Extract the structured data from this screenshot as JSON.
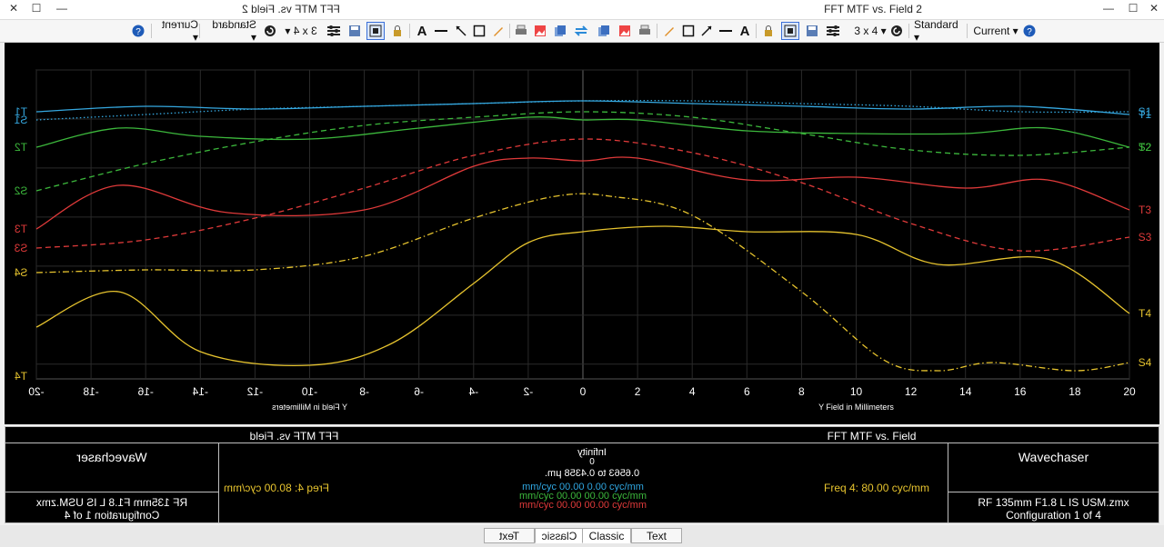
{
  "window": {
    "title": "FFT MTF vs. Field 2",
    "title_mirrored": "FFT MTF vs. Field 2",
    "controls": {
      "minimize": "—",
      "maximize": "☐",
      "close": "✕"
    }
  },
  "toolbar_left": {
    "buttons": [
      "Current ▾",
      "Standard ▾",
      "3 x 4 ▾"
    ]
  },
  "toolbar_right": {
    "layout": "3 x 4 ▾",
    "standard": "Standard ▾",
    "current": "Current ▾"
  },
  "plot": {
    "left_x_label": "Y Field in Millimeters",
    "right_x_label": "Y Field in Millimeters",
    "x_ticks_left": [
      "-20",
      "-18",
      "-16",
      "-14",
      "-12",
      "-10",
      "-8",
      "-6",
      "-4",
      "-2",
      "0"
    ],
    "x_ticks_right": [
      "2",
      "4",
      "6",
      "8",
      "10",
      "12",
      "14",
      "16",
      "18",
      "20"
    ]
  },
  "chart_data": {
    "type": "line",
    "title": "FFT MTF vs. Field",
    "xlabel": "Y Field in Millimeters",
    "ylabel": "",
    "xlim": [
      -20,
      20
    ],
    "ylim": [
      0,
      1
    ],
    "grid": true,
    "series": [
      {
        "name": "T1",
        "color": "#35a8e0",
        "style": "solid",
        "x": [
          -20,
          -16,
          -12,
          -8,
          -4,
          0,
          4,
          8,
          12,
          16,
          20
        ],
        "y": [
          0.94,
          0.96,
          0.95,
          0.96,
          0.97,
          0.98,
          0.97,
          0.96,
          0.95,
          0.96,
          0.93
        ]
      },
      {
        "name": "S1",
        "color": "#35a8e0",
        "style": "dotted",
        "x": [
          -20,
          -16,
          -12,
          -8,
          -4,
          0,
          4,
          8,
          12,
          16,
          20
        ],
        "y": [
          0.91,
          0.93,
          0.95,
          0.96,
          0.97,
          0.98,
          0.98,
          0.97,
          0.96,
          0.94,
          0.94
        ]
      },
      {
        "name": "T2",
        "color": "#3cb83c",
        "style": "solid",
        "x": [
          -20,
          -17,
          -14,
          -10,
          -6,
          -2,
          0,
          2,
          6,
          10,
          14,
          17,
          20
        ],
        "y": [
          0.81,
          0.88,
          0.85,
          0.84,
          0.88,
          0.92,
          0.91,
          0.91,
          0.87,
          0.86,
          0.86,
          0.88,
          0.81
        ]
      },
      {
        "name": "S2",
        "color": "#3cb83c",
        "style": "dashed",
        "x": [
          -20,
          -16,
          -12,
          -8,
          -4,
          0,
          4,
          8,
          12,
          16,
          20
        ],
        "y": [
          0.65,
          0.75,
          0.83,
          0.89,
          0.92,
          0.94,
          0.92,
          0.86,
          0.8,
          0.78,
          0.81
        ]
      },
      {
        "name": "T3",
        "color": "#e03a3a",
        "style": "solid",
        "x": [
          -20,
          -17,
          -13,
          -8,
          -4,
          -2,
          0,
          2,
          6,
          10,
          14,
          17,
          20
        ],
        "y": [
          0.51,
          0.67,
          0.57,
          0.58,
          0.74,
          0.77,
          0.76,
          0.77,
          0.69,
          0.7,
          0.66,
          0.69,
          0.58
        ]
      },
      {
        "name": "S3",
        "color": "#e03a3a",
        "style": "dashed",
        "x": [
          -20,
          -16,
          -12,
          -8,
          -4,
          0,
          4,
          8,
          12,
          16,
          20
        ],
        "y": [
          0.44,
          0.47,
          0.55,
          0.66,
          0.78,
          0.84,
          0.79,
          0.68,
          0.53,
          0.43,
          0.48
        ]
      },
      {
        "name": "T4",
        "color": "#e6c32e",
        "style": "solid",
        "x": [
          -20,
          -17,
          -14,
          -10,
          -7,
          -4,
          -2,
          0,
          3,
          6,
          10,
          13,
          17,
          20
        ],
        "y": [
          0.15,
          0.28,
          0.06,
          0.01,
          0.09,
          0.31,
          0.46,
          0.5,
          0.52,
          0.5,
          0.49,
          0.38,
          0.4,
          0.2
        ]
      },
      {
        "name": "S4",
        "color": "#e6c32e",
        "style": "dashdot",
        "x": [
          -20,
          -16,
          -12,
          -8,
          -4,
          -1,
          1,
          4,
          8,
          11,
          13,
          15,
          18,
          20
        ],
        "y": [
          0.35,
          0.36,
          0.36,
          0.41,
          0.55,
          0.63,
          0.63,
          0.56,
          0.28,
          0.03,
          -0.01,
          0.02,
          -0.01,
          0.02
        ]
      }
    ],
    "left_labels": [
      "T1",
      "S1",
      "T2",
      "S2",
      "T3",
      "S3",
      "S4",
      "T4"
    ],
    "right_labels": [
      "S1",
      "T1",
      "S2",
      "T2",
      "T3",
      "S3",
      "T4",
      "S4"
    ]
  },
  "info": {
    "title_right": "FFT MTF vs. Field",
    "title_left_mirrored": "FFT MTF vs. Field",
    "company_right": "Wavechaser",
    "company_left_mirrored": "Wavechaser",
    "center_line1": "Infinity",
    "center_line2": "0",
    "center_line3": "0.6563 to 0.4358 μm.",
    "freq_left": "Freq 4:   80.00 cyc/mm",
    "freq_right": "Freq 4:   80.00 cyc/mm",
    "color_lines": [
      {
        "text": "mm/cyc 00.00 0.00 cyc/mm",
        "color": "#2fa6e0"
      },
      {
        "text": "mm/cyc 00.00 00.00 cyc/mm",
        "color": "#3cb83c"
      },
      {
        "text": "mm/cyc 00.00 00.00 cyc/mm",
        "color": "#e03a3a"
      }
    ],
    "file_right": "RF 135mm F1.8 L IS USM.zmx",
    "config_right": "Configuration 1 of 4",
    "file_left_mirrored": "RF 135mm F1.8 L IS USM.zmx",
    "config_left_mirrored": "Configuration 1 of 4"
  },
  "tabs": {
    "left_text_mirrored": "Text",
    "left_classic_mirrored": "Classic",
    "classic": "Classic",
    "text": "Text"
  }
}
